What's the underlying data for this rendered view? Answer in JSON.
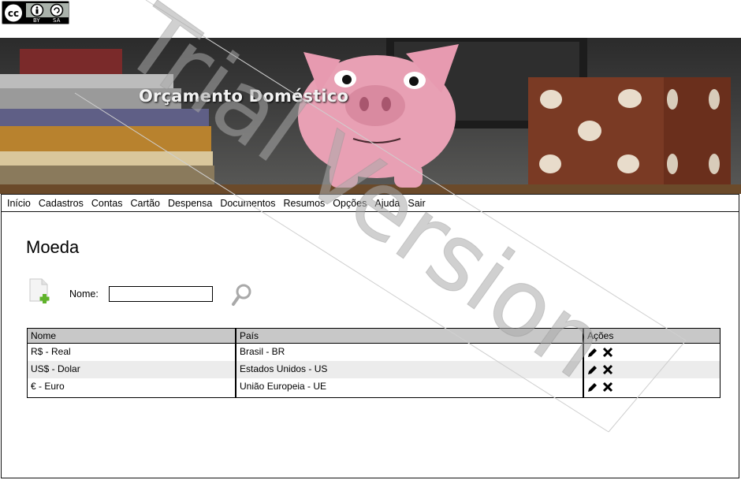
{
  "app": {
    "title": "Orçamento Doméstico"
  },
  "license": {
    "badge_labels": [
      "BY",
      "SA"
    ]
  },
  "menu": {
    "items": [
      "Início",
      "Cadastros",
      "Contas",
      "Cartão",
      "Despensa",
      "Documentos",
      "Resumos",
      "Opções",
      "Ajuda",
      "Sair"
    ]
  },
  "page": {
    "title": "Moeda"
  },
  "search": {
    "label": "Nome:",
    "value": ""
  },
  "table": {
    "columns": [
      "Nome",
      "País",
      "Ações"
    ],
    "rows": [
      {
        "nome": "R$ - Real",
        "pais": "Brasil - BR"
      },
      {
        "nome": "US$ - Dolar",
        "pais": "Estados Unidos - US"
      },
      {
        "nome": "€ - Euro",
        "pais": "União Europeia - UE"
      }
    ]
  },
  "watermark": {
    "text": "Trial Version"
  }
}
